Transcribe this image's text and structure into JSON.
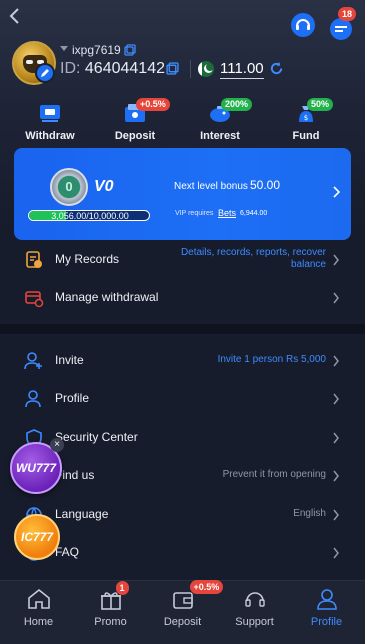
{
  "header": {
    "back_icon": "chevron-left-icon",
    "support_icon": "headset-icon",
    "message_badge": "18"
  },
  "user": {
    "username": "ixpg7619",
    "id_label": "ID:",
    "id_value": "464044142",
    "balance": "111.00"
  },
  "quick_actions": [
    {
      "label": "Withdraw",
      "icon": "withdraw-icon",
      "tag": ""
    },
    {
      "label": "Deposit",
      "icon": "deposit-icon",
      "tag": "+0.5%"
    },
    {
      "label": "Interest",
      "icon": "interest-icon",
      "tag": "200%"
    },
    {
      "label": "Fund",
      "icon": "fund-icon",
      "tag": "50%"
    }
  ],
  "vip": {
    "medal_text": "0",
    "level": "V0",
    "progress_text": "3,056.00/10,000.00",
    "progress": 0.3056,
    "next_level_label": "Next level bonus",
    "next_level_value": "50.00",
    "requires_label": "VIP requires",
    "bets_label": "Bets",
    "requires_value": "6,944.00"
  },
  "menu_top": [
    {
      "label": "My Records",
      "value": "Details, records, reports, recover balance"
    },
    {
      "label": "Manage withdrawal",
      "value": ""
    }
  ],
  "menu_bottom": [
    {
      "label": "Invite",
      "value": "Invite 1 person Rs 5,000"
    },
    {
      "label": "Profile",
      "value": ""
    },
    {
      "label": "Security Center",
      "value": ""
    },
    {
      "label": "Find us",
      "value": "Prevent it from opening"
    },
    {
      "label": "Language",
      "value": "English"
    },
    {
      "label": "FAQ",
      "value": ""
    }
  ],
  "floating": {
    "app1": "WU777",
    "app2": "IC777",
    "close": "×"
  },
  "nav": [
    {
      "label": "Home",
      "badge": ""
    },
    {
      "label": "Promo",
      "badge": "1"
    },
    {
      "label": "Deposit",
      "badge": "+0.5%"
    },
    {
      "label": "Support",
      "badge": ""
    },
    {
      "label": "Profile",
      "badge": ""
    }
  ],
  "colors": {
    "accent_blue": "#1d6ff5",
    "badge_red": "#e6453b",
    "badge_green": "#22b14c",
    "link_blue": "#3d8bff"
  }
}
